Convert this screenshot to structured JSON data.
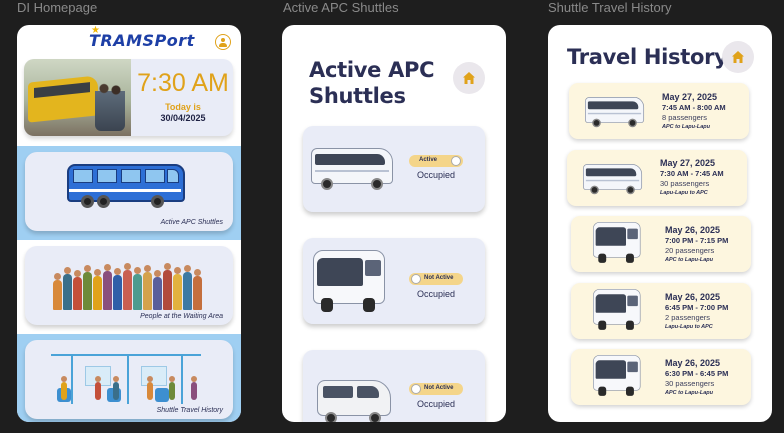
{
  "frames": {
    "home": "DI Homepage",
    "shuttles": "Active APC Shuttles",
    "history": "Shuttle Travel History"
  },
  "home": {
    "logo": "TRAMSPort",
    "time": "7:30 AM",
    "today_label": "Today is",
    "date": "30/04/2025",
    "cards": [
      {
        "caption": "Active APC Shuttles"
      },
      {
        "caption": "People at the Waiting Area"
      },
      {
        "caption": "Shuttle Travel History"
      }
    ],
    "colors": {
      "accent": "#e0a21a",
      "selected_panel": "#9fcff2",
      "navy": "#2b2f55"
    }
  },
  "shuttles": {
    "title_line1": "Active APC",
    "title_line2": "Shuttles",
    "items": [
      {
        "status": "Active",
        "occupancy": "Occupied",
        "vehicle": "coach-bus"
      },
      {
        "status": "Not Active",
        "occupancy": "Occupied",
        "vehicle": "city-bus"
      },
      {
        "status": "Not Active",
        "occupancy": "Occupied",
        "vehicle": "van"
      }
    ]
  },
  "history": {
    "title": "Travel History",
    "trips": [
      {
        "date": "May 27, 2025",
        "time": "7:45 AM - 8:00 AM",
        "passengers": "8 passengers",
        "route": "APC to Lapu-Lapu",
        "vehicle": "coach-bus"
      },
      {
        "date": "May 27, 2025",
        "time": "7:30 AM - 7:45 AM",
        "passengers": "30 passengers",
        "route": "Lapu-Lapu to APC",
        "vehicle": "coach-bus"
      },
      {
        "date": "May 26, 2025",
        "time": "7:00 PM - 7:15 PM",
        "passengers": "20 passengers",
        "route": "APC to Lapu-Lapu",
        "vehicle": "city-bus"
      },
      {
        "date": "May 26, 2025",
        "time": "6:45 PM - 7:00 PM",
        "passengers": "2 passengers",
        "route": "Lapu-Lapu to APC",
        "vehicle": "city-bus"
      },
      {
        "date": "May 26, 2025",
        "time": "6:30 PM - 6:45 PM",
        "passengers": "30 passengers",
        "route": "APC to Lapu-Lapu",
        "vehicle": "city-bus"
      }
    ]
  }
}
